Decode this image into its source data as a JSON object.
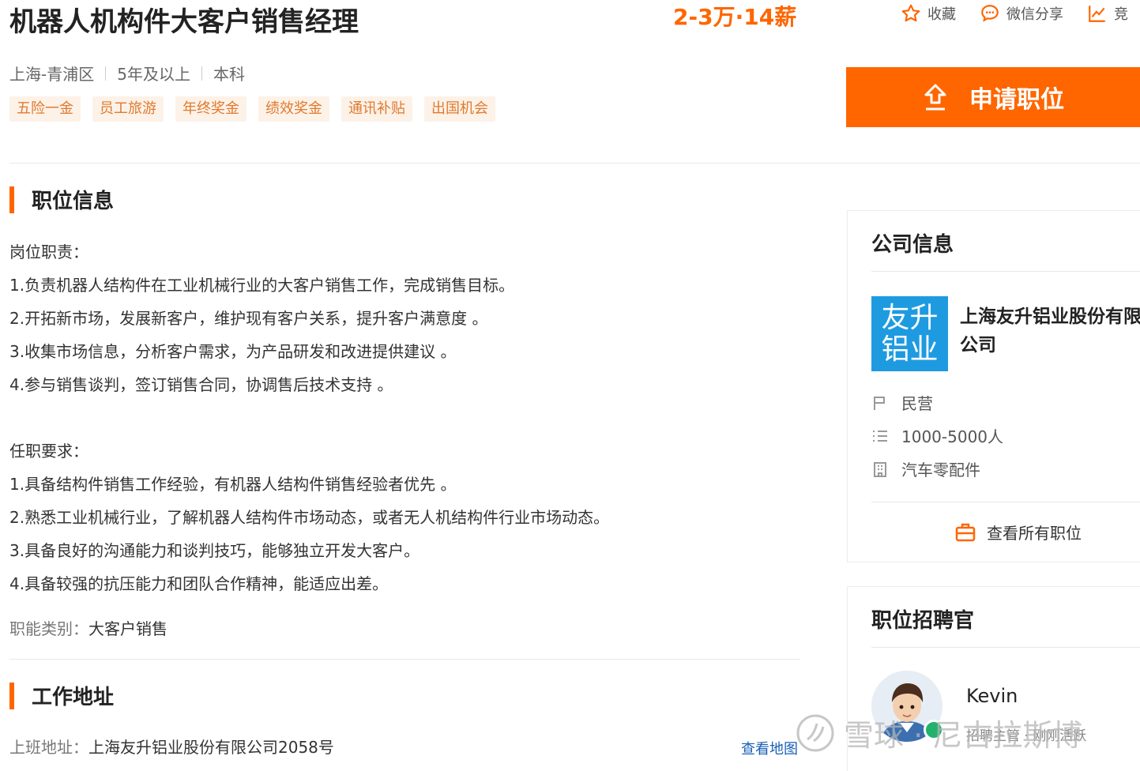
{
  "job": {
    "title": "机器人机构件大客户销售经理",
    "salary": "2-3万·14薪",
    "location": "上海-青浦区",
    "experience": "5年及以上",
    "education": "本科",
    "tags": [
      "五险一金",
      "员工旅游",
      "年终奖金",
      "绩效奖金",
      "通讯补贴",
      "出国机会"
    ]
  },
  "actions": {
    "favorite": "收藏",
    "wechat_share": "微信分享",
    "compete": "竞"
  },
  "apply_button": "申请职位",
  "job_info": {
    "section_title": "职位信息",
    "lines": [
      "岗位职责：",
      "1.负责机器人结构件在工业机械行业的大客户销售工作，完成销售目标。",
      "2.开拓新市场，发展新客户，维护现有客户关系，提升客户满意度 。",
      "3.收集市场信息，分析客户需求，为产品研发和改进提供建议 。",
      "4.参与销售谈判，签订销售合同，协调售后技术支持 。",
      "",
      "任职要求：",
      "1.具备结构件销售工作经验，有机器人结构件销售经验者优先 。",
      "2.熟悉工业机械行业，了解机器人结构件市场动态，或者无人机结构件行业市场动态。",
      "3.具备良好的沟通能力和谈判技巧，能够独立开发大客户。",
      "4.具备较强的抗压能力和团队合作精神，能适应出差。"
    ],
    "function_label": "职能类别：",
    "function_value": "大客户销售"
  },
  "work_address": {
    "section_title": "工作地址",
    "label": "上班地址：",
    "value": "上海友升铝业股份有限公司2058号",
    "map_link": "查看地图"
  },
  "company": {
    "section_title": "公司信息",
    "logo_line1": "友升",
    "logo_line2": "铝业",
    "name": "上海友升铝业股份有限公司",
    "type": "民营",
    "size": "1000-5000人",
    "industry": "汽车零配件",
    "all_jobs": "查看所有职位",
    "logo_color": "#1e9be0"
  },
  "recruiter": {
    "section_title": "职位招聘官",
    "name": "Kevin",
    "role": "招聘主管 · 刚刚活跃"
  },
  "watermark": "雪球 · 尼古拉斯博",
  "colors": {
    "accent": "#ff6600",
    "tag_bg": "#fdf2e8",
    "tag_text": "#e07a2e",
    "link": "#1a5fb4",
    "online": "#23b26d"
  }
}
